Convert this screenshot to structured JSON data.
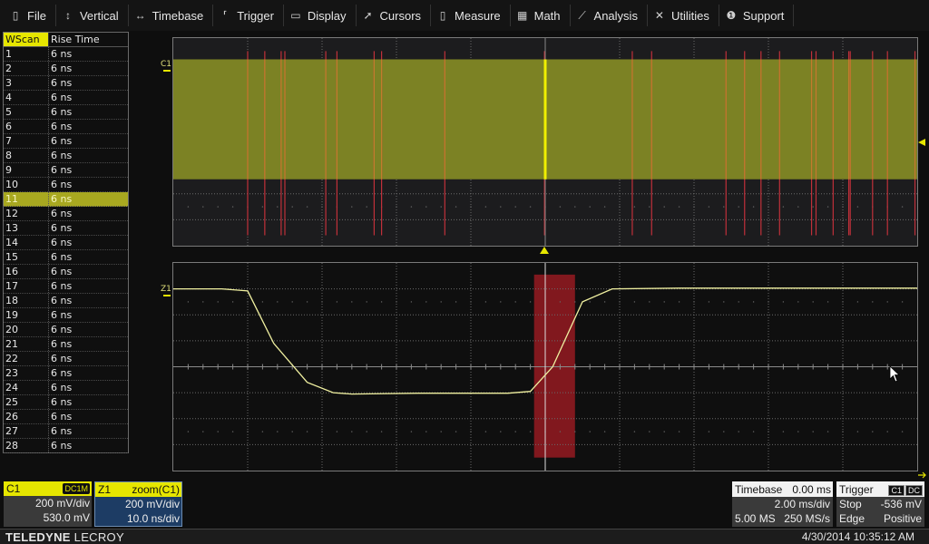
{
  "menu": [
    {
      "label": "File",
      "icon": "clipboard-icon",
      "glyph": "▯"
    },
    {
      "label": "Vertical",
      "icon": "vertical-arrows-icon",
      "glyph": "↕"
    },
    {
      "label": "Timebase",
      "icon": "horizontal-arrows-icon",
      "glyph": "↔"
    },
    {
      "label": "Trigger",
      "icon": "trigger-flag-icon",
      "glyph": "⸢"
    },
    {
      "label": "Display",
      "icon": "display-icon",
      "glyph": "▭"
    },
    {
      "label": "Cursors",
      "icon": "cursor-arrow-icon",
      "glyph": "➚"
    },
    {
      "label": "Measure",
      "icon": "ruler-icon",
      "glyph": "▯"
    },
    {
      "label": "Math",
      "icon": "calculator-icon",
      "glyph": "▦"
    },
    {
      "label": "Analysis",
      "icon": "chart-icon",
      "glyph": "⟋"
    },
    {
      "label": "Utilities",
      "icon": "tools-icon",
      "glyph": "✕"
    },
    {
      "label": "Support",
      "icon": "info-icon",
      "glyph": "❶"
    }
  ],
  "table": {
    "headers": [
      "WScan",
      "Rise Time"
    ],
    "selected_row": 11,
    "rows": [
      [
        "1",
        "6 ns"
      ],
      [
        "2",
        "6 ns"
      ],
      [
        "3",
        "6 ns"
      ],
      [
        "4",
        "6 ns"
      ],
      [
        "5",
        "6 ns"
      ],
      [
        "6",
        "6 ns"
      ],
      [
        "7",
        "6 ns"
      ],
      [
        "8",
        "6 ns"
      ],
      [
        "9",
        "6 ns"
      ],
      [
        "10",
        "6 ns"
      ],
      [
        "11",
        "6 ns"
      ],
      [
        "12",
        "6 ns"
      ],
      [
        "13",
        "6 ns"
      ],
      [
        "14",
        "6 ns"
      ],
      [
        "15",
        "6 ns"
      ],
      [
        "16",
        "6 ns"
      ],
      [
        "17",
        "6 ns"
      ],
      [
        "18",
        "6 ns"
      ],
      [
        "19",
        "6 ns"
      ],
      [
        "20",
        "6 ns"
      ],
      [
        "21",
        "6 ns"
      ],
      [
        "22",
        "6 ns"
      ],
      [
        "23",
        "6 ns"
      ],
      [
        "24",
        "6 ns"
      ],
      [
        "25",
        "6 ns"
      ],
      [
        "26",
        "6 ns"
      ],
      [
        "27",
        "6 ns"
      ],
      [
        "28",
        "6 ns"
      ]
    ]
  },
  "upper": {
    "label": "C1",
    "colors": {
      "band": "#7c8224",
      "marker": "#c0303a",
      "selected": "#f0f000"
    },
    "marker_positions_div": [
      1.0,
      1.23,
      1.45,
      1.5,
      2.05,
      2.2,
      2.7,
      2.8,
      3.65,
      4.99,
      6.17,
      6.43,
      7.43,
      7.68,
      7.9,
      8.15,
      8.58,
      8.64,
      8.87,
      9.08,
      9.1,
      9.4,
      9.6,
      9.97
    ],
    "selected_position_div": 5.0,
    "band_top_div": 0.82,
    "band_bottom_div": 5.44
  },
  "lower": {
    "label": "Z1",
    "trace_color": "#f0f0a0",
    "trace_points_div": [
      [
        0,
        1.0
      ],
      [
        0.65,
        1.0
      ],
      [
        1.0,
        1.08
      ],
      [
        1.35,
        3.1
      ],
      [
        1.8,
        4.6
      ],
      [
        2.15,
        5.0
      ],
      [
        2.4,
        5.05
      ],
      [
        3.3,
        5.02
      ],
      [
        4.5,
        5.02
      ],
      [
        4.5,
        5.02
      ],
      [
        4.8,
        4.95
      ],
      [
        5.1,
        4.0
      ],
      [
        5.5,
        1.5
      ],
      [
        5.9,
        1.0
      ],
      [
        6.8,
        0.97
      ],
      [
        10,
        0.97
      ]
    ],
    "highlight_div": [
      4.85,
      5.4
    ],
    "highlight_color": "#8e1a20"
  },
  "channel_c1": {
    "name": "C1",
    "coupling": "DC1M",
    "vdiv": "200 mV/div",
    "offset": "530.0 mV"
  },
  "channel_z1": {
    "name": "Z1",
    "source": "zoom(C1)",
    "vdiv": "200 mV/div",
    "tdiv": "10.0 ns/div"
  },
  "timebase": {
    "label": "Timebase",
    "delay": "0.00 ms",
    "tdiv": "2.00 ms/div",
    "samples": "5.00 MS",
    "rate": "250 MS/s"
  },
  "trigger": {
    "label": "Trigger",
    "source": "C1",
    "coupling": "DC",
    "mode": "Stop",
    "level": "-536 mV",
    "type": "Edge",
    "slope": "Positive"
  },
  "footer": {
    "brand_bold": "TELEDYNE",
    "brand_light": " LECROY",
    "datetime": "4/30/2014 10:35:12 AM"
  }
}
